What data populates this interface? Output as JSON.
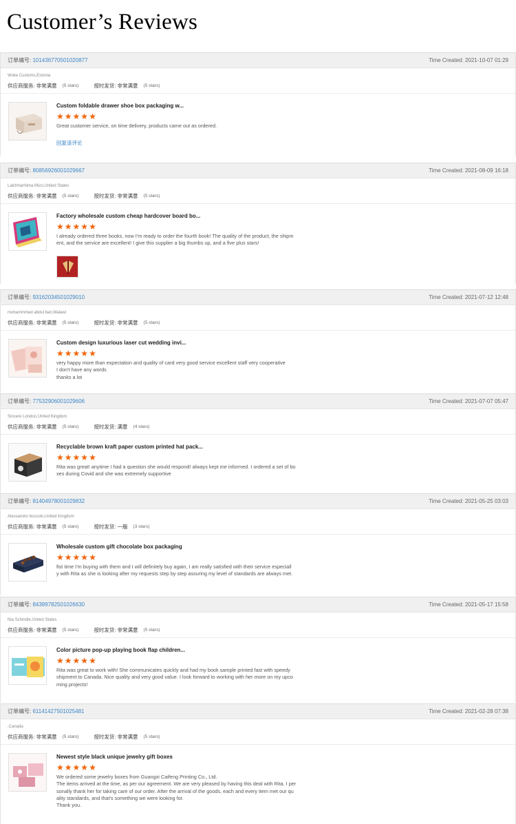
{
  "page": {
    "title": "Customer’s Reviews"
  },
  "labels": {
    "order_no": "订单编号: ",
    "time_created": "Time Created: ",
    "supplier_service": "供应商服务: ",
    "on_time_delivery": "按时发货: "
  },
  "colors": {
    "star": "#f0640a",
    "link": "#3b85c6",
    "header_bg": "#f0f0f0"
  },
  "reviews": [
    {
      "order_no": "101436770501020877",
      "time": "2021-10-07 01:29",
      "buyer": "Woke Customs,Estonia",
      "service": "非常满意",
      "service_stars": "(5 stars)",
      "delivery": "非常满意",
      "delivery_stars": "(5 stars)",
      "product": "Custom foldable drawer shoe box packaging w...",
      "rating": 5,
      "comment": "Great customer service, on time delivery, products came out as ordered.",
      "reply_link": "回复该评论",
      "icon": "drawer-box-icon"
    },
    {
      "order_no": "80856926001029667",
      "time": "2021-08-09 16:18",
      "buyer": "Lalchhanhima Mizo,United States",
      "service": "非常满意",
      "service_stars": "(5 stars)",
      "delivery": "非常满意",
      "delivery_stars": "(5 stars)",
      "product": "Factory wholesale custom cheap hardcover board bo...",
      "rating": 5,
      "comment": "I already ordered three books, now I'm ready to order the fourth book! The quality of the product, the shipm\nent, and the service are excellent! I give this supplier a big thumbs up, and a five plus stars!",
      "icon": "board-book-icon",
      "photo_icon": "book-photo-icon"
    },
    {
      "order_no": "93162034501029010",
      "time": "2021-07-12 12:48",
      "buyer": "mohammmed abdul bari,Malawi",
      "service": "非常满意",
      "service_stars": "(5 stars)",
      "delivery": "非常满意",
      "delivery_stars": "(5 stars)",
      "product": "Custom design luxurious laser cut wedding invi...",
      "rating": 5,
      "comment": "very happy more than expectation and quality of card very good service excellent staff very cooperative\nI don't have any words\nthanks a lot",
      "icon": "wedding-invitation-icon"
    },
    {
      "order_no": "77532906001029606",
      "time": "2021-07-07 05:47",
      "buyer": "Sincere London,United Kingdom",
      "service": "非常满意",
      "service_stars": "(5 stars)",
      "delivery": "满意",
      "delivery_stars": "(4 stars)",
      "product": "Recyclable brown kraft paper custom printed hat pack...",
      "rating": 5,
      "comment": "Rita was great! anytime I had a question she would respond! always kept me informed. I ordered a set of bo\nxes during Covid and she was extremely supportive",
      "icon": "kraft-box-icon"
    },
    {
      "order_no": "81404978001029832",
      "time": "2021-05-25 03:03",
      "buyer": "Alessandro boscolo,United Kingdom",
      "service": "非常满意",
      "service_stars": "(5 stars)",
      "delivery": "一般",
      "delivery_stars": "(3 stars)",
      "product": "Wholesale custom gift chocolate box packaging",
      "rating": 5,
      "comment": "fist time I'm buying with them and I will definitely buy again, I am really satisfied with their service especiall\ny with Rita as she is looking after my requests step by step assuring my level of standards are always met.",
      "icon": "chocolate-box-icon"
    },
    {
      "order_no": "84389782501026630",
      "time": "2021-05-17 15:58",
      "buyer": "Nia Schindle,United States",
      "service": "非常满意",
      "service_stars": "(5 stars)",
      "delivery": "非常满意",
      "delivery_stars": "(5 stars)",
      "product": "Color picture pop-up playing book flap children...",
      "rating": 5,
      "comment": "Rita was great to work with! She communicates quickly and had my book sample printed fast with speedy\nshipment to Canada. Nice quality and very good value. I look forward to working with her more on my upco\nming projects!",
      "icon": "popup-book-icon"
    },
    {
      "order_no": "61141427501025481",
      "time": "2021-02-28 07:38",
      "buyer": ",Canada",
      "service": "非常满意",
      "service_stars": "(5 stars)",
      "delivery": "非常满意",
      "delivery_stars": "(5 stars)",
      "product": "Newest style black unique jewelry gift boxes",
      "rating": 5,
      "comment": "We ordered some jewelry boxes from Guangxi Caifeng Printing Co., Ltd.\nThe items arrived at the time, as per our agreement. We are very pleased by having this deal with Rita. I per\nsonally thank her for taking care of our order. After the arrival of the goods, each and every item met our qu\nality standards, and that's something we were looking for.\nThank you.",
      "icon": "jewelry-box-icon"
    }
  ]
}
